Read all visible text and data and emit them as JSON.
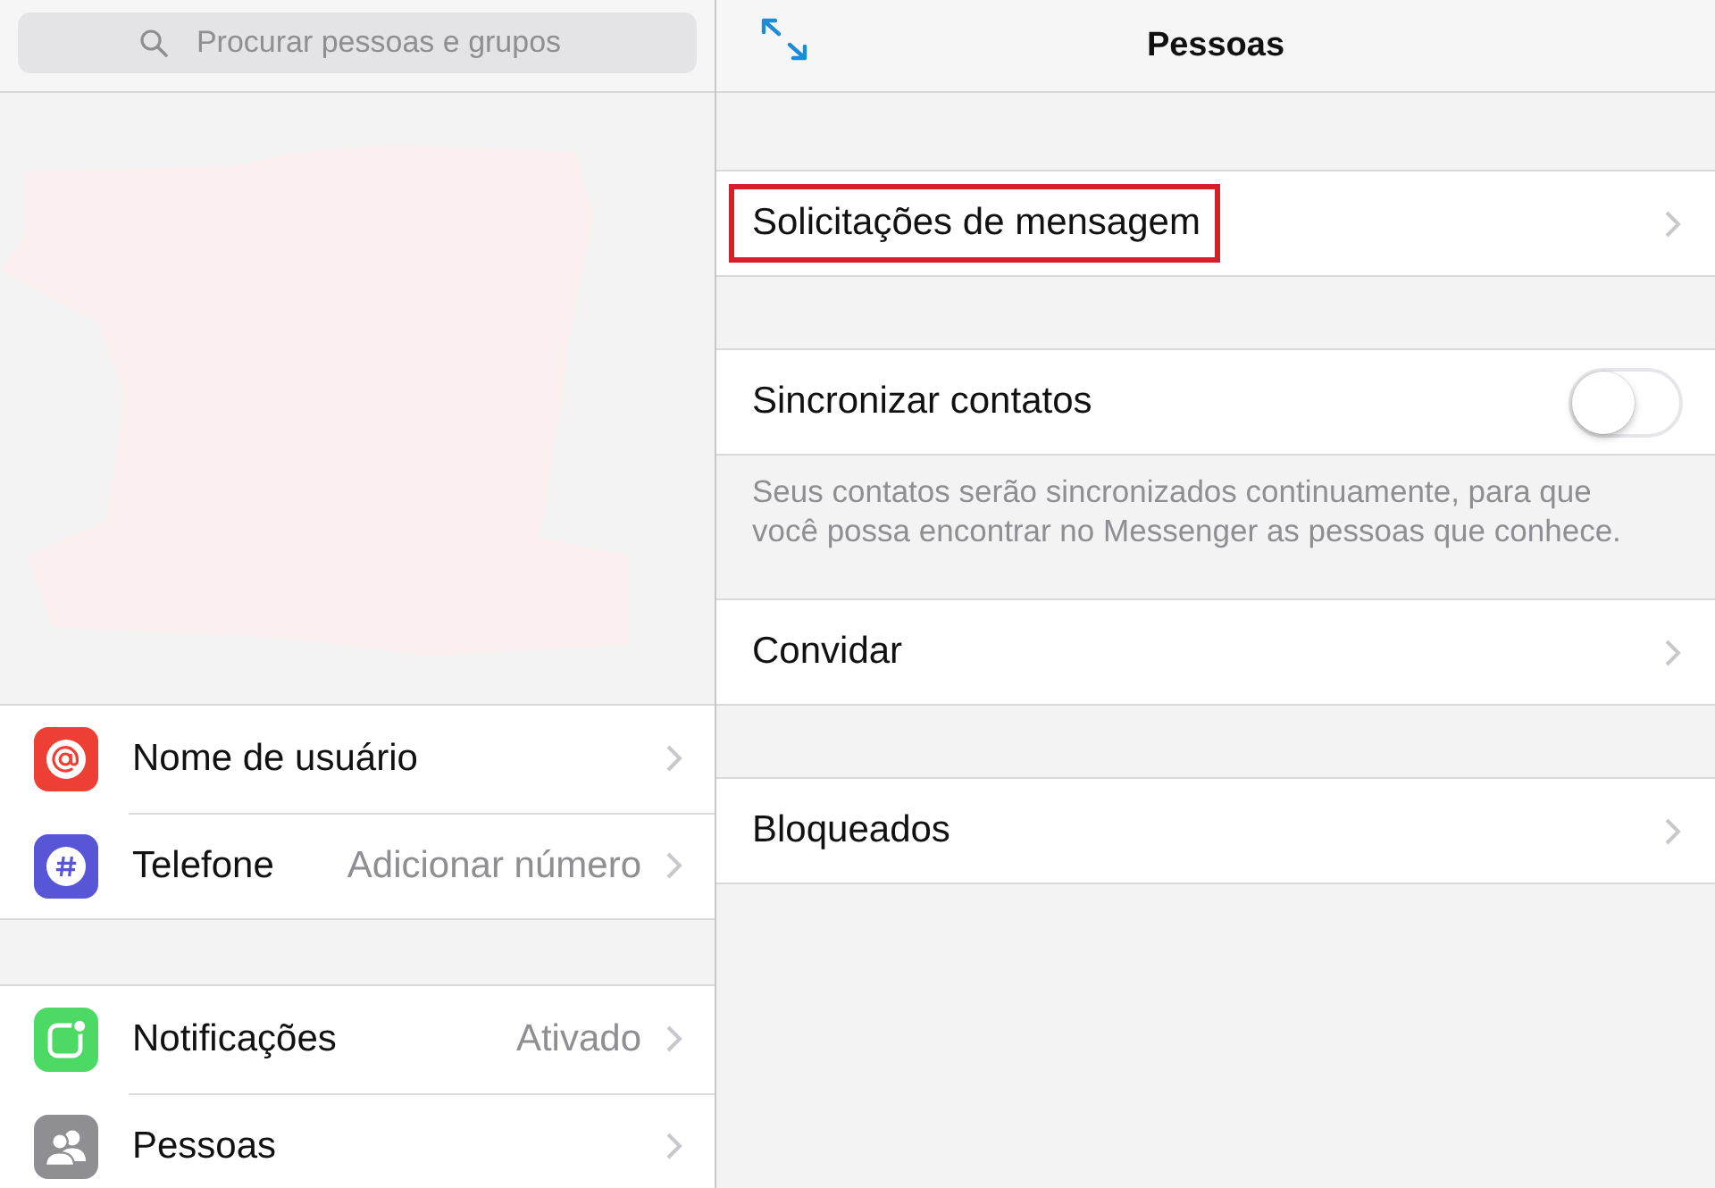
{
  "search": {
    "placeholder": "Procurar pessoas e grupos"
  },
  "sidebar": {
    "groups": [
      {
        "items": [
          {
            "kind": "username",
            "label": "Nome de usuário"
          },
          {
            "kind": "phone",
            "label": "Telefone",
            "value": "Adicionar número"
          }
        ]
      },
      {
        "items": [
          {
            "kind": "notifications",
            "label": "Notificações",
            "value": "Ativado"
          },
          {
            "kind": "people",
            "label": "Pessoas"
          }
        ]
      }
    ]
  },
  "header": {
    "title": "Pessoas"
  },
  "sections": [
    {
      "rows": [
        {
          "kind": "link",
          "label": "Solicitações de mensagem",
          "highlighted": true
        }
      ]
    },
    {
      "rows": [
        {
          "kind": "toggle",
          "label": "Sincronizar contatos",
          "on": false
        }
      ],
      "footer": "Seus contatos serão sincronizados continuamente, para que você possa encontrar no Messenger as pessoas que conhece."
    },
    {
      "rows": [
        {
          "kind": "link",
          "label": "Convidar",
          "highlighted": false
        }
      ]
    },
    {
      "rows": [
        {
          "kind": "link",
          "label": "Bloqueados",
          "highlighted": false
        }
      ]
    }
  ]
}
